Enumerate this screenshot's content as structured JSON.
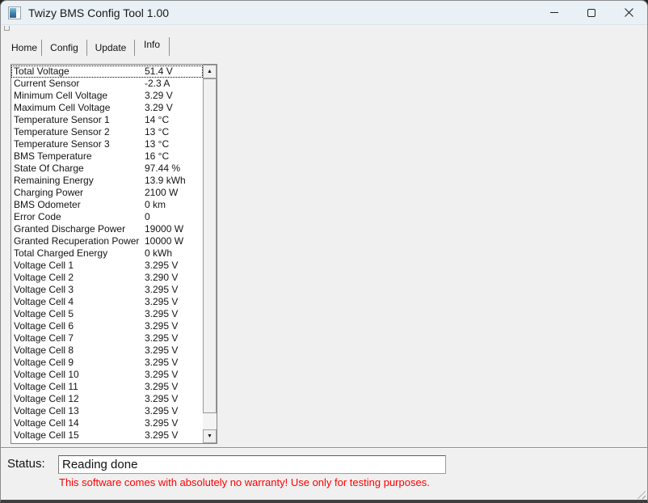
{
  "window": {
    "title": "Twizy BMS Config Tool 1.00"
  },
  "tabs": [
    {
      "label": "Home",
      "selected": false
    },
    {
      "label": "Config",
      "selected": false
    },
    {
      "label": "Update",
      "selected": false
    },
    {
      "label": "Info",
      "selected": true
    }
  ],
  "info_list": {
    "rows": [
      {
        "label": "Total Voltage",
        "value": "51.4 V",
        "focused": true
      },
      {
        "label": "Current Sensor",
        "value": "-2.3 A"
      },
      {
        "label": "Minimum Cell Voltage",
        "value": "3.29 V"
      },
      {
        "label": "Maximum Cell Voltage",
        "value": "3.29 V"
      },
      {
        "label": "Temperature Sensor 1",
        "value": "14 °C"
      },
      {
        "label": "Temperature Sensor 2",
        "value": "13 °C"
      },
      {
        "label": "Temperature Sensor 3",
        "value": "13 °C"
      },
      {
        "label": "BMS Temperature",
        "value": "16 °C"
      },
      {
        "label": "State Of Charge",
        "value": "97.44 %"
      },
      {
        "label": "Remaining Energy",
        "value": "13.9 kWh"
      },
      {
        "label": "Charging Power",
        "value": "2100 W"
      },
      {
        "label": "BMS Odometer",
        "value": "0 km"
      },
      {
        "label": "Error Code",
        "value": "0"
      },
      {
        "label": "Granted Discharge Power",
        "value": "19000 W"
      },
      {
        "label": "Granted Recuperation Power",
        "value": "10000 W"
      },
      {
        "label": "Total Charged Energy",
        "value": "0 kWh"
      },
      {
        "label": "Voltage Cell 1",
        "value": "3.295 V"
      },
      {
        "label": "Voltage Cell 2",
        "value": "3.290 V"
      },
      {
        "label": "Voltage Cell 3",
        "value": "3.295 V"
      },
      {
        "label": "Voltage Cell 4",
        "value": "3.295 V"
      },
      {
        "label": "Voltage Cell 5",
        "value": "3.295 V"
      },
      {
        "label": "Voltage Cell 6",
        "value": "3.295 V"
      },
      {
        "label": "Voltage Cell 7",
        "value": "3.295 V"
      },
      {
        "label": "Voltage Cell 8",
        "value": "3.295 V"
      },
      {
        "label": "Voltage Cell 9",
        "value": "3.295 V"
      },
      {
        "label": "Voltage Cell 10",
        "value": "3.295 V"
      },
      {
        "label": "Voltage Cell 11",
        "value": "3.295 V"
      },
      {
        "label": "Voltage Cell 12",
        "value": "3.295 V"
      },
      {
        "label": "Voltage Cell 13",
        "value": "3.295 V"
      },
      {
        "label": "Voltage Cell 14",
        "value": "3.295 V"
      },
      {
        "label": "Voltage Cell 15",
        "value": "3.295 V"
      }
    ]
  },
  "scrollbar": {
    "up_arrow": "▲",
    "down_arrow": "▼"
  },
  "status": {
    "label": "Status:",
    "value": "Reading done",
    "warning": "This software comes with absolutely no warranty! Use only for testing purposes."
  },
  "colors": {
    "titlebar": "#e9f1f6",
    "client_background": "#f0f0f0",
    "warning_text": "#ff0000",
    "listbox_background": "#ffffff"
  }
}
